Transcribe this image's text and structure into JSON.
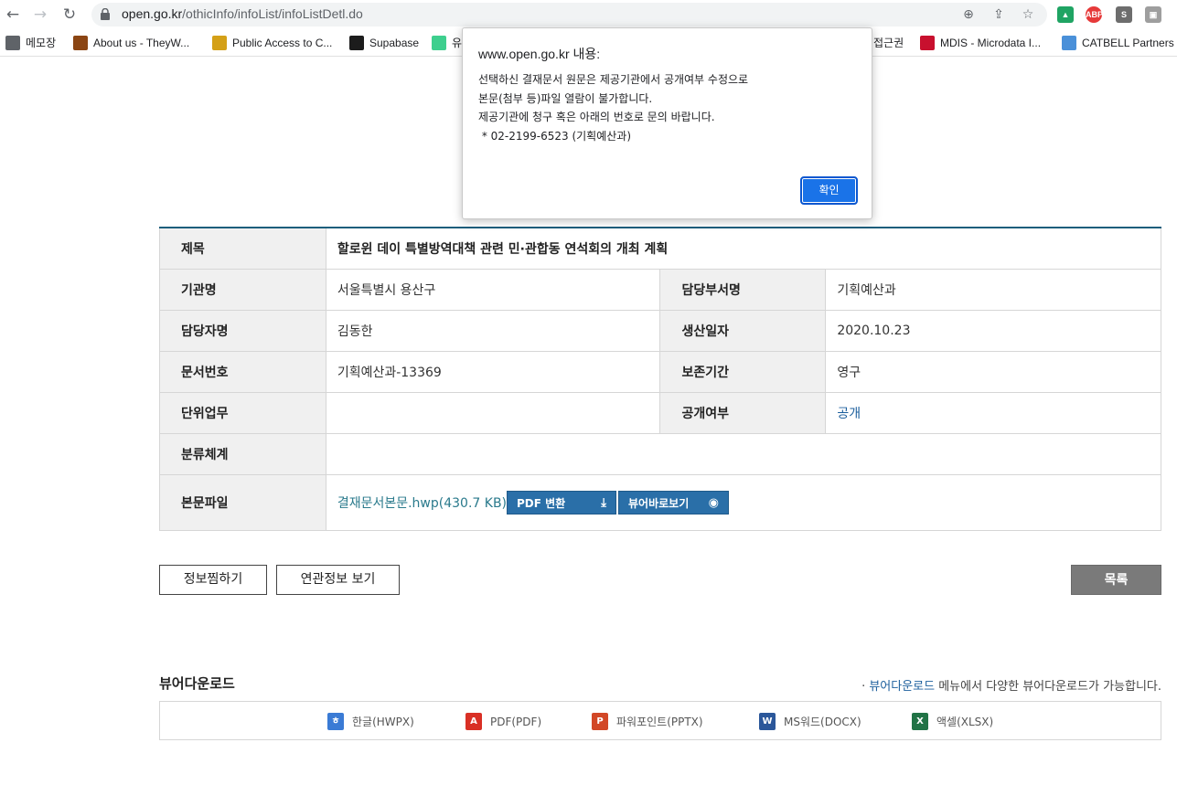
{
  "browser": {
    "url_host": "open.go.kr",
    "url_path": "/othicInfo/infoList/infoListDetl.do",
    "bookmarks": [
      {
        "label": "메모장",
        "color": "#5f6368"
      },
      {
        "label": "About us - TheyW...",
        "color": "#8b4513"
      },
      {
        "label": "Public Access to C...",
        "color": "#d4a017"
      },
      {
        "label": "Supabase",
        "color": "#1c1c1c"
      },
      {
        "label": "유",
        "color": "#3ecf8e"
      },
      {
        "label": "접근권",
        "color": "#ffffff"
      },
      {
        "label": "MDIS - Microdata I...",
        "color": "#c8102e"
      },
      {
        "label": "CATBELL Partners",
        "color": "#4a90d9"
      }
    ],
    "extensions": [
      {
        "label": "▲",
        "color": "#1fa463"
      },
      {
        "label": "ABP",
        "color": "#e63939"
      },
      {
        "label": "S",
        "color": "#6d6d6d"
      },
      {
        "label": "▣",
        "color": "#9e9e9e"
      }
    ]
  },
  "dialog": {
    "title": "www.open.go.kr 내용:",
    "lines": [
      "선택하신 결재문서 원문은 제공기관에서 공개여부 수정으로",
      "본문(첨부 등)파일 열람이 불가합니다.",
      "제공기관에 청구 혹은 아래의 번호로 문의 바랍니다.",
      " * 02-2199-6523 (기획예산과)"
    ],
    "ok_label": "확인"
  },
  "detail": {
    "title_label": "제목",
    "title_value": "할로윈 데이 특별방역대책 관련 민·관합동 연석회의 개최 계획",
    "org_label": "기관명",
    "org_value": "서울특별시 용산구",
    "dept_label": "담당부서명",
    "dept_value": "기획예산과",
    "person_label": "담당자명",
    "person_value": "김동한",
    "date_label": "생산일자",
    "date_value": "2020.10.23",
    "docno_label": "문서번호",
    "docno_value": "기획예산과-13369",
    "retention_label": "보존기간",
    "retention_value": "영구",
    "unit_label": "단위업무",
    "unit_value": "",
    "public_label": "공개여부",
    "public_value": "공개",
    "class_label": "분류체계",
    "class_value": "",
    "file_label": "본문파일",
    "file_name": "결재문서본문.hwp(430.7 KB)",
    "pdf_button": "PDF 변환",
    "viewer_button": "뷰어바로보기"
  },
  "actions": {
    "bookmark_label": "정보찜하기",
    "related_label": "연관정보 보기",
    "list_label": "목록"
  },
  "viewer_download": {
    "title": "뷰어다운로드",
    "note_link": "뷰어다운로드",
    "note_rest": " 메뉴에서 다양한 뷰어다운로드가 가능합니다.",
    "note_prefix": "· ",
    "items": [
      {
        "label": "한글(HWPX)",
        "color": "#3a7bd5",
        "icon": "hwp-icon",
        "glyph": "ㅎ"
      },
      {
        "label": "PDF(PDF)",
        "color": "#d93025",
        "icon": "pdf-icon",
        "glyph": "A"
      },
      {
        "label": "파워포인트(PPTX)",
        "color": "#d24726",
        "icon": "powerpoint-icon",
        "glyph": "P"
      },
      {
        "label": "MS워드(DOCX)",
        "color": "#2b579a",
        "icon": "word-icon",
        "glyph": "W"
      },
      {
        "label": "액셀(XLSX)",
        "color": "#217346",
        "icon": "excel-icon",
        "glyph": "X"
      }
    ]
  }
}
